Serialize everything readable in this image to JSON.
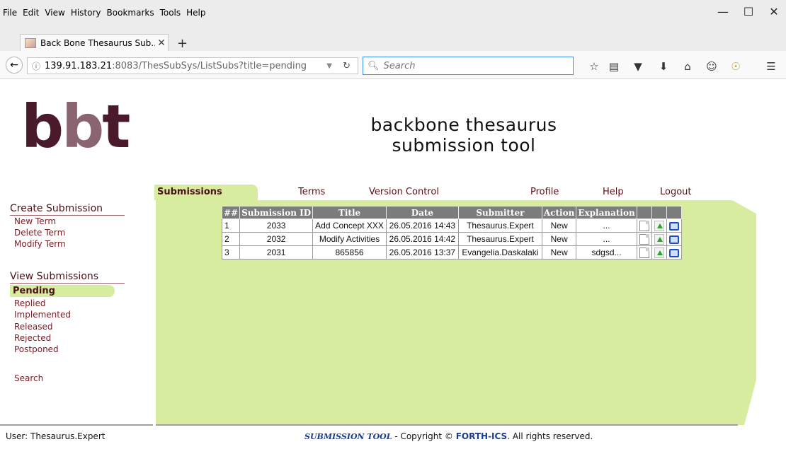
{
  "browser": {
    "menu": [
      "File",
      "Edit",
      "View",
      "History",
      "Bookmarks",
      "Tools",
      "Help"
    ],
    "window_controls": {
      "minimize": "—",
      "maximize": "☐",
      "close": "✕"
    },
    "tab_title": "Back Bone Thesaurus Sub...",
    "tab_close": "✕",
    "new_tab": "+",
    "url_host": "139.91.183.21",
    "url_rest": ":8083/ThesSubSys/ListSubs?title=pending",
    "search_placeholder": "Search"
  },
  "header": {
    "logo": [
      "b",
      "b",
      "t"
    ],
    "title_line1": "backbone thesaurus",
    "title_line2": "submission tool"
  },
  "topnav": {
    "active": "Submissions",
    "items": [
      "Terms",
      "Version Control",
      "Profile",
      "Help",
      "Logout"
    ]
  },
  "sidebar": {
    "create_heading": "Create Submission",
    "create_links": [
      "New Term",
      "Delete Term",
      "Modify Term"
    ],
    "view_heading": "View Submissions",
    "view_active": "Pending",
    "view_links": [
      "Replied",
      "Implemented",
      "Released",
      "Rejected",
      "Postponed"
    ],
    "search": "Search"
  },
  "table": {
    "headers": [
      "##",
      "Submission ID",
      "Title",
      "Date",
      "Submitter",
      "Action",
      "Explanation",
      "",
      "",
      ""
    ],
    "rows": [
      {
        "n": "1",
        "id": "2033",
        "title": "Add Concept XXX",
        "date": "26.05.2016 14:43",
        "submitter": "Thesaurus.Expert",
        "action": "New",
        "explanation": "..."
      },
      {
        "n": "2",
        "id": "2032",
        "title": "Modify Activities",
        "date": "26.05.2016 14:42",
        "submitter": "Thesaurus.Expert",
        "action": "New",
        "explanation": "..."
      },
      {
        "n": "3",
        "id": "2031",
        "title": "865856",
        "date": "26.05.2016 13:37",
        "submitter": "Evangelia.Daskalaki",
        "action": "New",
        "explanation": "sdgsd..."
      }
    ]
  },
  "footer": {
    "user": "User: Thesaurus.Expert",
    "tool": "SUBMISSION TOOL",
    "mid": " - Copyright © ",
    "forth": "FORTH-ICS",
    "end": ". All rights reserved."
  }
}
